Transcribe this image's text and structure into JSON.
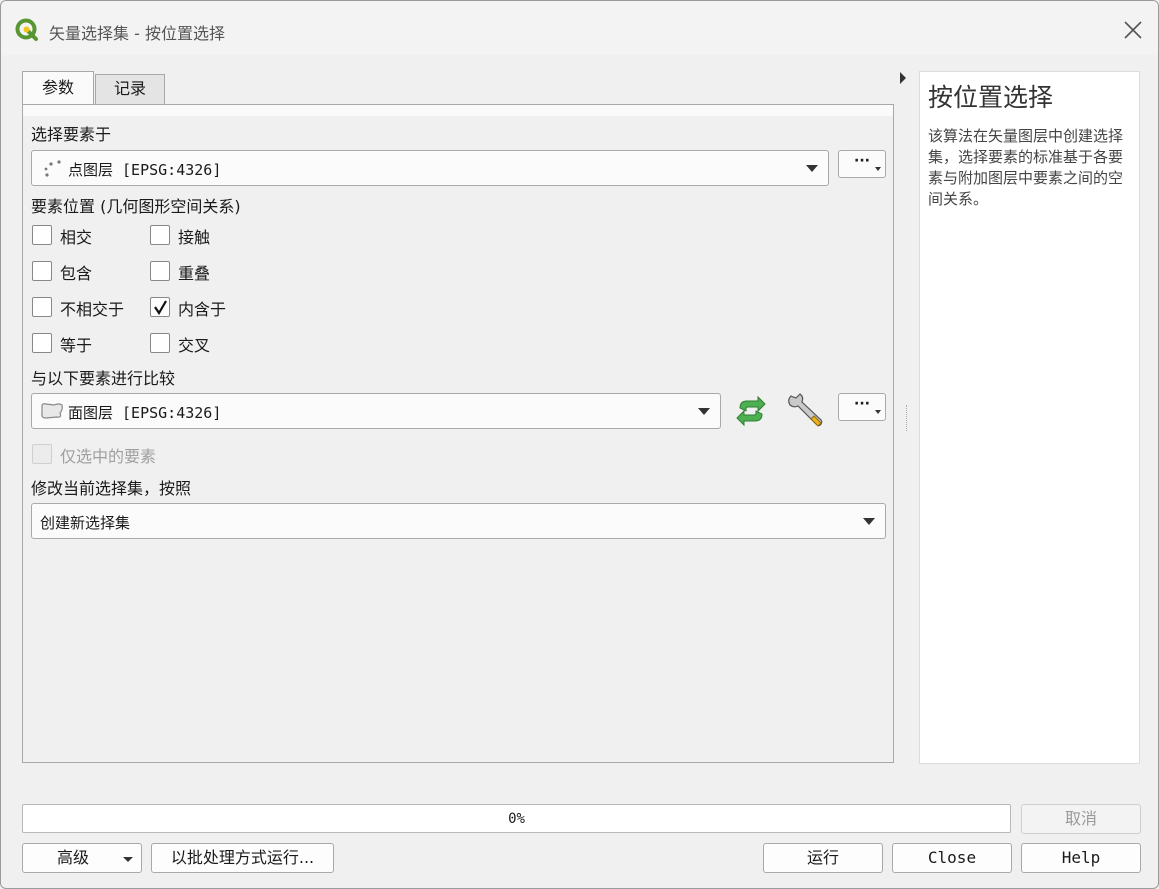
{
  "window": {
    "title": "矢量选择集 - 按位置选择"
  },
  "tabs": [
    {
      "label": "参数",
      "active": true
    },
    {
      "label": "记录",
      "active": false
    }
  ],
  "params": {
    "select_from_label": "选择要素于",
    "select_from_value": "点图层 [EPSG:4326]",
    "predicate_label": "要素位置 (几何图形空间关系)",
    "predicates": [
      {
        "label": "相交",
        "checked": false
      },
      {
        "label": "接触",
        "checked": false
      },
      {
        "label": "包含",
        "checked": false
      },
      {
        "label": "重叠",
        "checked": false
      },
      {
        "label": "不相交于",
        "checked": false
      },
      {
        "label": "内含于",
        "checked": true
      },
      {
        "label": "等于",
        "checked": false
      },
      {
        "label": "交叉",
        "checked": false
      }
    ],
    "compare_label": "与以下要素进行比较",
    "compare_value": "面图层 [EPSG:4326]",
    "selected_only_label": "仅选中的要素",
    "selected_only_checked": false,
    "modify_label": "修改当前选择集，按照",
    "modify_value": "创建新选择集",
    "dots_label": "···"
  },
  "help": {
    "title": "按位置选择",
    "body": "该算法在矢量图层中创建选择集，选择要素的标准基于各要素与附加图层中要素之间的空间关系。"
  },
  "progress": {
    "percent": 0,
    "label": "0%"
  },
  "buttons": {
    "cancel": "取消",
    "advanced": "高级",
    "batch": "以批处理方式运行...",
    "run": "运行",
    "close": "Close",
    "help": "Help"
  },
  "colors": {
    "qgis_green": "#589632",
    "qgis_yellow": "#f0c419",
    "refresh_green": "#4caf50"
  }
}
